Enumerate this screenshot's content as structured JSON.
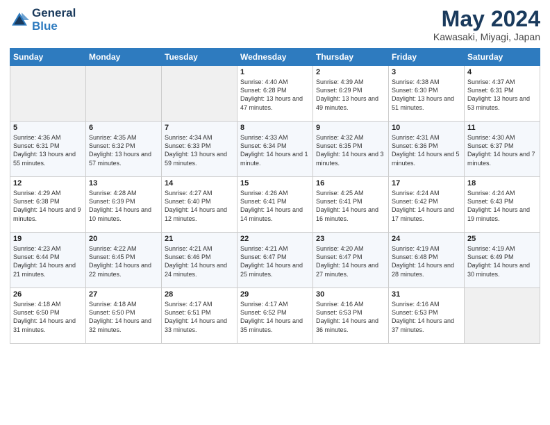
{
  "header": {
    "logo_line1": "General",
    "logo_line2": "Blue",
    "title": "May 2024",
    "subtitle": "Kawasaki, Miyagi, Japan"
  },
  "days_of_week": [
    "Sunday",
    "Monday",
    "Tuesday",
    "Wednesday",
    "Thursday",
    "Friday",
    "Saturday"
  ],
  "weeks": [
    [
      {
        "day": "",
        "info": ""
      },
      {
        "day": "",
        "info": ""
      },
      {
        "day": "",
        "info": ""
      },
      {
        "day": "1",
        "info": "Sunrise: 4:40 AM\nSunset: 6:28 PM\nDaylight: 13 hours\nand 47 minutes."
      },
      {
        "day": "2",
        "info": "Sunrise: 4:39 AM\nSunset: 6:29 PM\nDaylight: 13 hours\nand 49 minutes."
      },
      {
        "day": "3",
        "info": "Sunrise: 4:38 AM\nSunset: 6:30 PM\nDaylight: 13 hours\nand 51 minutes."
      },
      {
        "day": "4",
        "info": "Sunrise: 4:37 AM\nSunset: 6:31 PM\nDaylight: 13 hours\nand 53 minutes."
      }
    ],
    [
      {
        "day": "5",
        "info": "Sunrise: 4:36 AM\nSunset: 6:31 PM\nDaylight: 13 hours\nand 55 minutes."
      },
      {
        "day": "6",
        "info": "Sunrise: 4:35 AM\nSunset: 6:32 PM\nDaylight: 13 hours\nand 57 minutes."
      },
      {
        "day": "7",
        "info": "Sunrise: 4:34 AM\nSunset: 6:33 PM\nDaylight: 13 hours\nand 59 minutes."
      },
      {
        "day": "8",
        "info": "Sunrise: 4:33 AM\nSunset: 6:34 PM\nDaylight: 14 hours\nand 1 minute."
      },
      {
        "day": "9",
        "info": "Sunrise: 4:32 AM\nSunset: 6:35 PM\nDaylight: 14 hours\nand 3 minutes."
      },
      {
        "day": "10",
        "info": "Sunrise: 4:31 AM\nSunset: 6:36 PM\nDaylight: 14 hours\nand 5 minutes."
      },
      {
        "day": "11",
        "info": "Sunrise: 4:30 AM\nSunset: 6:37 PM\nDaylight: 14 hours\nand 7 minutes."
      }
    ],
    [
      {
        "day": "12",
        "info": "Sunrise: 4:29 AM\nSunset: 6:38 PM\nDaylight: 14 hours\nand 9 minutes."
      },
      {
        "day": "13",
        "info": "Sunrise: 4:28 AM\nSunset: 6:39 PM\nDaylight: 14 hours\nand 10 minutes."
      },
      {
        "day": "14",
        "info": "Sunrise: 4:27 AM\nSunset: 6:40 PM\nDaylight: 14 hours\nand 12 minutes."
      },
      {
        "day": "15",
        "info": "Sunrise: 4:26 AM\nSunset: 6:41 PM\nDaylight: 14 hours\nand 14 minutes."
      },
      {
        "day": "16",
        "info": "Sunrise: 4:25 AM\nSunset: 6:41 PM\nDaylight: 14 hours\nand 16 minutes."
      },
      {
        "day": "17",
        "info": "Sunrise: 4:24 AM\nSunset: 6:42 PM\nDaylight: 14 hours\nand 17 minutes."
      },
      {
        "day": "18",
        "info": "Sunrise: 4:24 AM\nSunset: 6:43 PM\nDaylight: 14 hours\nand 19 minutes."
      }
    ],
    [
      {
        "day": "19",
        "info": "Sunrise: 4:23 AM\nSunset: 6:44 PM\nDaylight: 14 hours\nand 21 minutes."
      },
      {
        "day": "20",
        "info": "Sunrise: 4:22 AM\nSunset: 6:45 PM\nDaylight: 14 hours\nand 22 minutes."
      },
      {
        "day": "21",
        "info": "Sunrise: 4:21 AM\nSunset: 6:46 PM\nDaylight: 14 hours\nand 24 minutes."
      },
      {
        "day": "22",
        "info": "Sunrise: 4:21 AM\nSunset: 6:47 PM\nDaylight: 14 hours\nand 25 minutes."
      },
      {
        "day": "23",
        "info": "Sunrise: 4:20 AM\nSunset: 6:47 PM\nDaylight: 14 hours\nand 27 minutes."
      },
      {
        "day": "24",
        "info": "Sunrise: 4:19 AM\nSunset: 6:48 PM\nDaylight: 14 hours\nand 28 minutes."
      },
      {
        "day": "25",
        "info": "Sunrise: 4:19 AM\nSunset: 6:49 PM\nDaylight: 14 hours\nand 30 minutes."
      }
    ],
    [
      {
        "day": "26",
        "info": "Sunrise: 4:18 AM\nSunset: 6:50 PM\nDaylight: 14 hours\nand 31 minutes."
      },
      {
        "day": "27",
        "info": "Sunrise: 4:18 AM\nSunset: 6:50 PM\nDaylight: 14 hours\nand 32 minutes."
      },
      {
        "day": "28",
        "info": "Sunrise: 4:17 AM\nSunset: 6:51 PM\nDaylight: 14 hours\nand 33 minutes."
      },
      {
        "day": "29",
        "info": "Sunrise: 4:17 AM\nSunset: 6:52 PM\nDaylight: 14 hours\nand 35 minutes."
      },
      {
        "day": "30",
        "info": "Sunrise: 4:16 AM\nSunset: 6:53 PM\nDaylight: 14 hours\nand 36 minutes."
      },
      {
        "day": "31",
        "info": "Sunrise: 4:16 AM\nSunset: 6:53 PM\nDaylight: 14 hours\nand 37 minutes."
      },
      {
        "day": "",
        "info": ""
      }
    ]
  ]
}
